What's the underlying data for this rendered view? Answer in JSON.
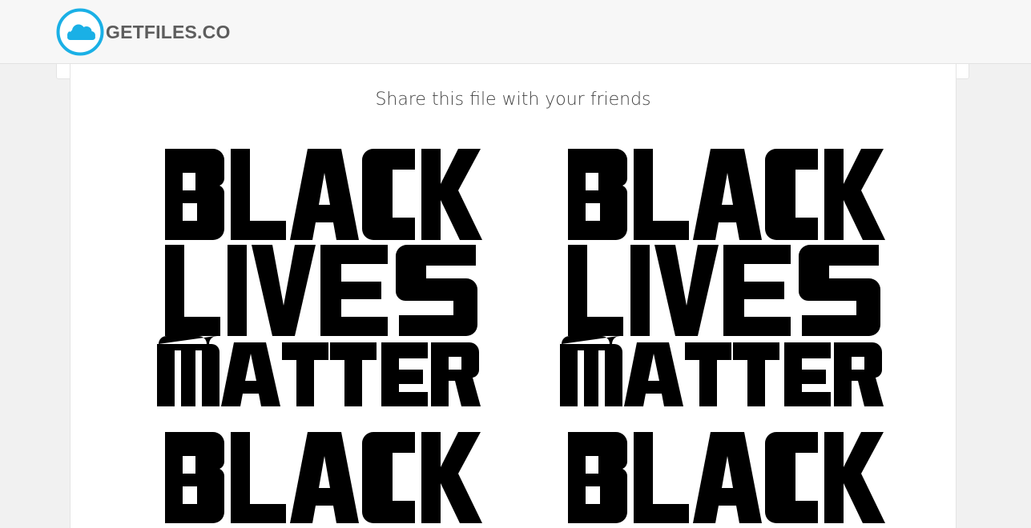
{
  "header": {
    "brand_name": "GETFILES.CO",
    "logo_icon": "cloud-icon",
    "brand_color": "#1ab0e6"
  },
  "card": {
    "share_heading": "Share this file with your friends"
  },
  "preview": {
    "columns": 2,
    "lines": [
      "BLACK",
      "LIVES",
      "MATTER",
      "BLACK"
    ]
  }
}
